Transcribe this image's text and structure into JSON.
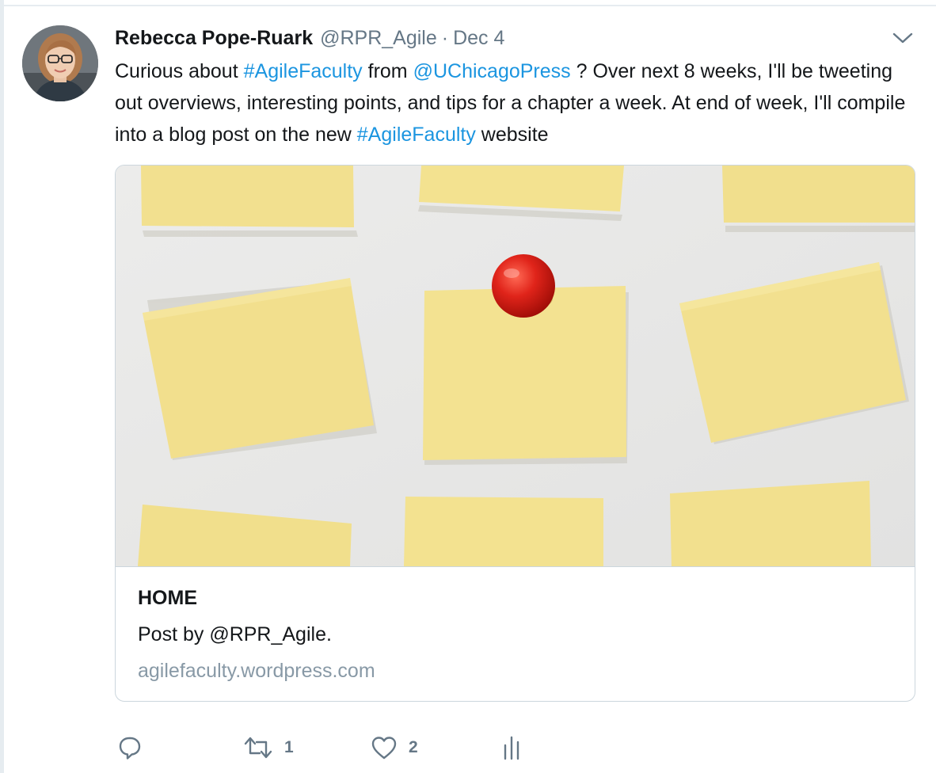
{
  "tweet": {
    "author_name": "Rebecca Pope-Ruark",
    "handle": "@RPR_Agile",
    "separator": "·",
    "date": "Dec 4",
    "text_parts": {
      "t1": "Curious about ",
      "l1": "#AgileFaculty",
      "t2": " from ",
      "l2": "@UChicagoPress",
      "t3": " ? Over next 8 weeks, I'll be tweeting out overviews, interesting points, and tips for a chapter a week. At end of week, I'll compile into a blog post on the new ",
      "l3": "#AgileFaculty",
      "t4": " website"
    }
  },
  "card": {
    "title": "HOME",
    "description": "Post by @RPR_Agile.",
    "domain": "agilefaculty.wordpress.com"
  },
  "actions": {
    "retweet_count": "1",
    "like_count": "2"
  },
  "icons": {
    "caret": "chevron-down-icon",
    "reply": "reply-icon",
    "retweet": "retweet-icon",
    "like": "heart-icon",
    "analytics": "analytics-icon"
  },
  "colors": {
    "link": "#1b95e0",
    "secondary_text": "#657786",
    "domain_text": "#8899a6",
    "border": "#ccd6dd",
    "note_yellow": "#f2e08c",
    "pin_red": "#d91a12"
  }
}
